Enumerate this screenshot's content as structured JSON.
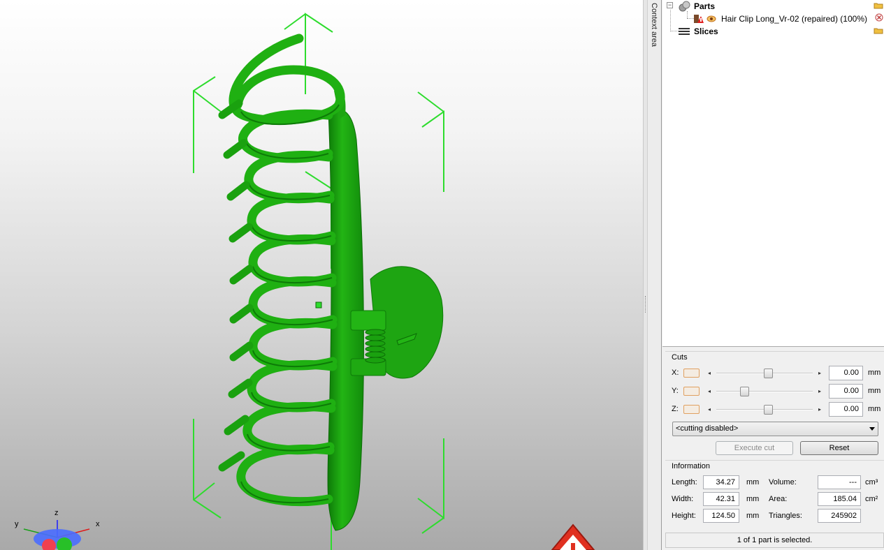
{
  "context_tab": {
    "label": "Context area"
  },
  "tree": {
    "parts_label": "Parts",
    "part_name": "Hair Clip Long_Vr-02 (repaired) (100%)",
    "slices_label": "Slices"
  },
  "cuts": {
    "title": "Cuts",
    "x": {
      "label": "X:",
      "value": "0.00",
      "unit": "mm",
      "slider_position": 0.54
    },
    "y": {
      "label": "Y:",
      "value": "0.00",
      "unit": "mm",
      "slider_position": 0.27
    },
    "z": {
      "label": "Z:",
      "value": "0.00",
      "unit": "mm",
      "slider_position": 0.54
    },
    "mode": "<cutting disabled>",
    "execute_label": "Execute cut",
    "reset_label": "Reset"
  },
  "info": {
    "title": "Information",
    "length_label": "Length:",
    "length": "34.27",
    "length_unit": "mm",
    "width_label": "Width:",
    "width": "42.31",
    "width_unit": "mm",
    "height_label": "Height:",
    "height": "124.50",
    "height_unit": "mm",
    "volume_label": "Volume:",
    "volume": "---",
    "volume_unit": "cm³",
    "area_label": "Area:",
    "area": "185.04",
    "area_unit": "cm²",
    "triangles_label": "Triangles:",
    "triangles": "245902"
  },
  "status": "1 of 1 part is selected.",
  "axes": {
    "x": "x",
    "y": "y",
    "z": "z"
  },
  "colors": {
    "model": "#1fae12",
    "bbox": "#2ddc2d",
    "warning": "#e03020"
  }
}
